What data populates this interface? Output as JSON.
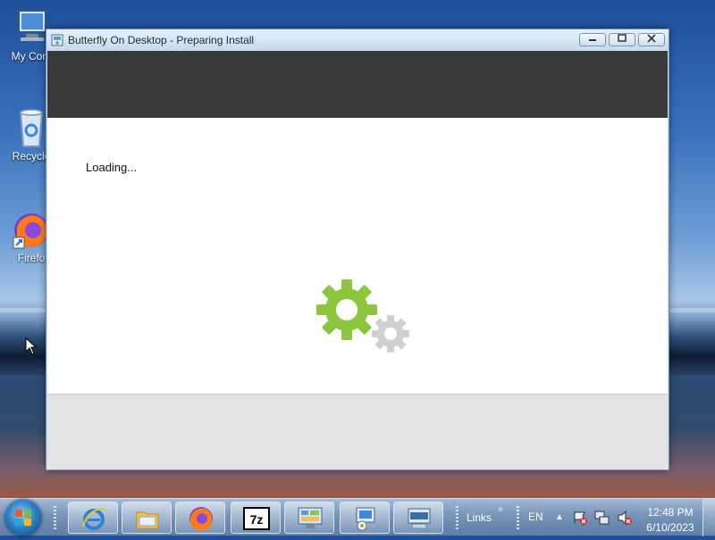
{
  "desktop": {
    "icons": [
      {
        "label": "My Com",
        "icon": "computer-icon"
      },
      {
        "label": "Recycle",
        "icon": "recycle-bin-icon"
      },
      {
        "label": "Firefo",
        "icon": "firefox-icon"
      }
    ]
  },
  "window": {
    "title": "Butterfly On Desktop - Preparing Install",
    "title_icon": "installer-icon",
    "controls": [
      "minimize-icon",
      "maximize-icon",
      "close-icon"
    ],
    "status_text": "Loading...",
    "colors": {
      "header_band": "#3a3a3a",
      "gear_primary": "#8cc63f",
      "gear_secondary": "#d0d0d0",
      "footer_band": "#e3e3e3"
    }
  },
  "taskbar": {
    "start_icon": "windows-start-icon",
    "pinned": [
      {
        "name": "internet-explorer-icon"
      },
      {
        "name": "file-explorer-icon"
      },
      {
        "name": "firefox-icon"
      },
      {
        "name": "7zip-icon",
        "text": "7z"
      },
      {
        "name": "control-panel-icon"
      },
      {
        "name": "installer-icon"
      },
      {
        "name": "keyboard-icon"
      }
    ],
    "links_label": "Links",
    "language": "EN",
    "tray_icons": [
      "action-center-icon",
      "network-icon",
      "volume-muted-icon"
    ],
    "clock": {
      "time": "12:48 PM",
      "date": "6/10/2023"
    }
  }
}
